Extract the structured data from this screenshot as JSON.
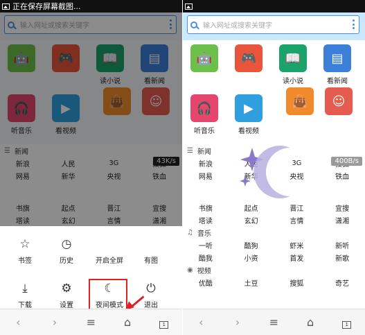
{
  "left": {
    "status_text": "正在保存屏幕截图...",
    "search_placeholder": "输入网址或搜索关键字",
    "tiles": [
      {
        "label": "",
        "color": "#6cc04a",
        "icon": "android-icon"
      },
      {
        "label": "",
        "color": "#e8553a",
        "icon": "gamepad-icon"
      },
      {
        "label": "读小说",
        "color": "#1aa36b",
        "icon": "book-icon"
      },
      {
        "label": "看新闻",
        "color": "#3b7fd8",
        "icon": "news-icon"
      },
      {
        "label": "听音乐",
        "color": "#e6456e",
        "icon": "headphones-icon"
      },
      {
        "label": "看视频",
        "color": "#2f9fe0",
        "icon": "play-icon"
      },
      {
        "label": "",
        "color": "#f08a2a",
        "icon": "shopping-bag-icon"
      },
      {
        "label": "",
        "color": "#e55b4f",
        "icon": "person-icon"
      }
    ],
    "news_header": "新闻",
    "speed": "43K/s",
    "news_rows": [
      [
        "新浪",
        "人民",
        "3G",
        "搜狐"
      ],
      [
        "网易",
        "新华",
        "央视",
        "铁血"
      ]
    ],
    "extra_rows": [
      [
        "书旗",
        "起点",
        "晋江",
        "宜搜"
      ],
      [
        "塔读",
        "玄幻",
        "言情",
        "潇湘"
      ]
    ],
    "menu": [
      {
        "label": "书签",
        "icon": "star-icon",
        "glyph": "☆"
      },
      {
        "label": "历史",
        "icon": "clock-icon",
        "glyph": "◷"
      },
      {
        "label": "开启全屏",
        "icon": "fullscreen-icon",
        "glyph": ""
      },
      {
        "label": "有图",
        "icon": "image-icon",
        "glyph": ""
      },
      {
        "label": "下载",
        "icon": "download-icon",
        "glyph": "⤓"
      },
      {
        "label": "设置",
        "icon": "gear-icon",
        "glyph": "⚙"
      },
      {
        "label": "夜间模式",
        "icon": "moon-icon",
        "glyph": "☾"
      },
      {
        "label": "退出",
        "icon": "power-icon",
        "glyph": "⏻"
      }
    ],
    "tab_count": "1"
  },
  "right": {
    "search_placeholder": "输入网址或搜索关键字",
    "tiles": [
      {
        "label": "",
        "color": "#6cc04a",
        "icon": "android-icon"
      },
      {
        "label": "",
        "color": "#e8553a",
        "icon": "gamepad-icon"
      },
      {
        "label": "读小说",
        "color": "#1aa36b",
        "icon": "book-icon"
      },
      {
        "label": "看新闻",
        "color": "#3b7fd8",
        "icon": "news-icon"
      },
      {
        "label": "听音乐",
        "color": "#e6456e",
        "icon": "headphones-icon"
      },
      {
        "label": "看视频",
        "color": "#2f9fe0",
        "icon": "play-icon"
      },
      {
        "label": "",
        "color": "#f08a2a",
        "icon": "shopping-bag-icon"
      },
      {
        "label": "",
        "color": "#e55b4f",
        "icon": "person-icon"
      }
    ],
    "news_header": "新闻",
    "speed": "400B/s",
    "news_rows": [
      [
        "新浪",
        "人民",
        "3G",
        "搜狐"
      ],
      [
        "网易",
        "新华",
        "央视",
        "铁血"
      ]
    ],
    "extra_rows": [
      [
        "书旗",
        "起点",
        "晋江",
        "宜搜"
      ],
      [
        "塔读",
        "玄幻",
        "言情",
        "潇湘"
      ]
    ],
    "music_header": "音乐",
    "music_rows": [
      [
        "一听",
        "酷狗",
        "虾米",
        "新听"
      ],
      [
        "酷我",
        "小资",
        "首发",
        "新歌"
      ]
    ],
    "video_header": "视频",
    "video_rows": [
      [
        "优酷",
        "土豆",
        "搜狐",
        "奇艺"
      ]
    ],
    "tab_count": "1"
  }
}
